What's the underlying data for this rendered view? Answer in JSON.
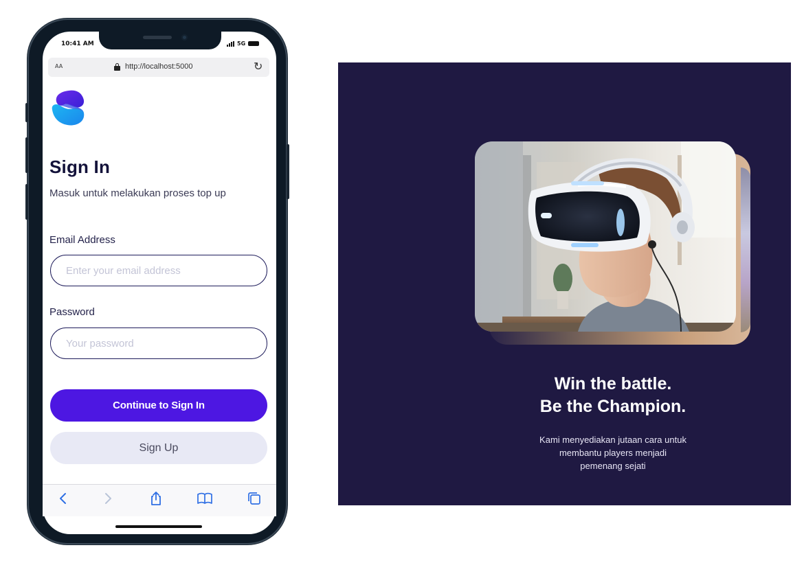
{
  "status_bar": {
    "time": "10:41 AM",
    "network": "5G"
  },
  "browser": {
    "text_size_label": "AA",
    "url": "http://localhost:5000",
    "toolbar_icons": [
      "back-icon",
      "forward-icon",
      "share-icon",
      "bookmarks-icon",
      "tabs-icon"
    ]
  },
  "signin": {
    "title": "Sign In",
    "subtitle": "Masuk untuk melakukan proses top up",
    "email_label": "Email Address",
    "email_placeholder": "Enter your email address",
    "email_value": "",
    "password_label": "Password",
    "password_placeholder": "Your password",
    "password_value": "",
    "continue_label": "Continue to Sign In",
    "signup_label": "Sign Up"
  },
  "promo": {
    "headline_line1": "Win the battle.",
    "headline_line2": "Be the Champion.",
    "text_line1": "Kami menyediakan jutaan cara untuk",
    "text_line2": "membantu players menjadi",
    "text_line3": "pemenang sejati"
  },
  "colors": {
    "primary": "#4d17e2",
    "secondary_bg": "#e8e9f5",
    "heading": "#13123a",
    "promo_bg": "#1f1942",
    "logo_blue": "#1fa4f0",
    "logo_purple": "#5b2ee6"
  }
}
